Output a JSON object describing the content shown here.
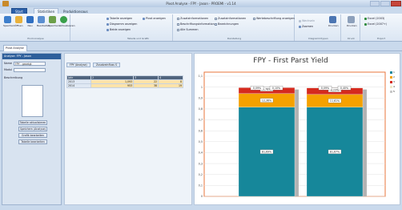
{
  "window": {
    "title": "Pivot Analyse - FPY - Jason - PROEMI - v1.14"
  },
  "tabs": [
    "Start",
    "Statistiken",
    "Produktionsaus"
  ],
  "ribbon": {
    "groups": [
      {
        "label": "Pivot-Analyse",
        "buttons": [
          "Speichern",
          "Öffnen",
          "Neu",
          "Bearbeiten",
          "Speichern",
          "Aktualisieren"
        ]
      },
      {
        "label": "Tabelle und Grafik",
        "items": [
          "Tabelle anzeigen",
          "Diagramm anzeigen",
          "Beide anzeigen",
          "Pivot anzeigen"
        ]
      },
      {
        "label": "Darstellung",
        "items": [
          "Zusatzinformationen",
          "Zusatzinformationen",
          "Wertebeschriftung anzeigen",
          "Beschriftungsinformation",
          "Bezeichnungen",
          "Alle Summen"
        ]
      },
      {
        "label": "Diagrammtypen",
        "items": [
          "Wechseln",
          "Zoomen",
          "Drucken"
        ]
      },
      {
        "label": "Druck",
        "items": [
          "Drucken"
        ]
      },
      {
        "label": "Export",
        "items": [
          "Excel (2003)",
          "Excel (2007+)"
        ]
      }
    ]
  },
  "doc_tab": "Pivot Analyse",
  "left_panel": {
    "title": "Analyse: FPY - Jason",
    "labels": [
      "Name",
      "Modul",
      "Beschreibung"
    ],
    "name_value": "FPY - gezeigt",
    "buttons": [
      "Tabelle aktualisieren",
      "Speichern (Analyse)",
      "Grafik bearbeiten",
      "Tabelle bearbeiten"
    ]
  },
  "middle": {
    "tabs": [
      "FPY (Analyse)",
      "Zusatzeinfluss S"
    ],
    "header": [
      "Jahr",
      "2",
      "3",
      "4"
    ],
    "rows": [
      {
        "label": "2013",
        "values": [
          "1,093",
          "22",
          "8"
        ]
      },
      {
        "label": "2014",
        "values": [
          "953",
          "38",
          "19"
        ]
      }
    ]
  },
  "chart_data": {
    "type": "bar",
    "title": "FPY - First Parst Yield",
    "ylim": [
      0,
      1.1
    ],
    "yticks": [
      "0",
      "0,1",
      "0,2",
      "0,3",
      "0,4",
      "0,5",
      "0,6",
      "0,7",
      "0,8",
      "0,9",
      "1",
      "1,1"
    ],
    "categories": [
      "2013",
      "2014"
    ],
    "series": [
      {
        "name": "",
        "color": "#16879a",
        "values": [
          0.8169,
          0.8167
        ]
      },
      {
        "name": "",
        "color": "#f5a100",
        "values": [
          0.1236,
          0.1161
        ]
      },
      {
        "name": "",
        "color": "#d52a1e",
        "values": [
          0.0576,
          0.0623
        ]
      },
      {
        "name": "",
        "color": "#f0e9c8",
        "values": [
          0.0009,
          0.0009
        ]
      },
      {
        "name": "",
        "color": "#c8c8c8",
        "values": [
          0.001,
          0.004
        ]
      }
    ],
    "data_labels": [
      [
        "81,69%",
        "12,36%",
        "5,76%",
        "0,09%",
        "0,10%"
      ],
      [
        "81,67%",
        "11,61%",
        "6,23%",
        "0,09%",
        "0,40%"
      ]
    ],
    "legend_position": "right",
    "legend": [
      "1",
      "2",
      "3",
      "4",
      "5"
    ],
    "grid": true
  }
}
